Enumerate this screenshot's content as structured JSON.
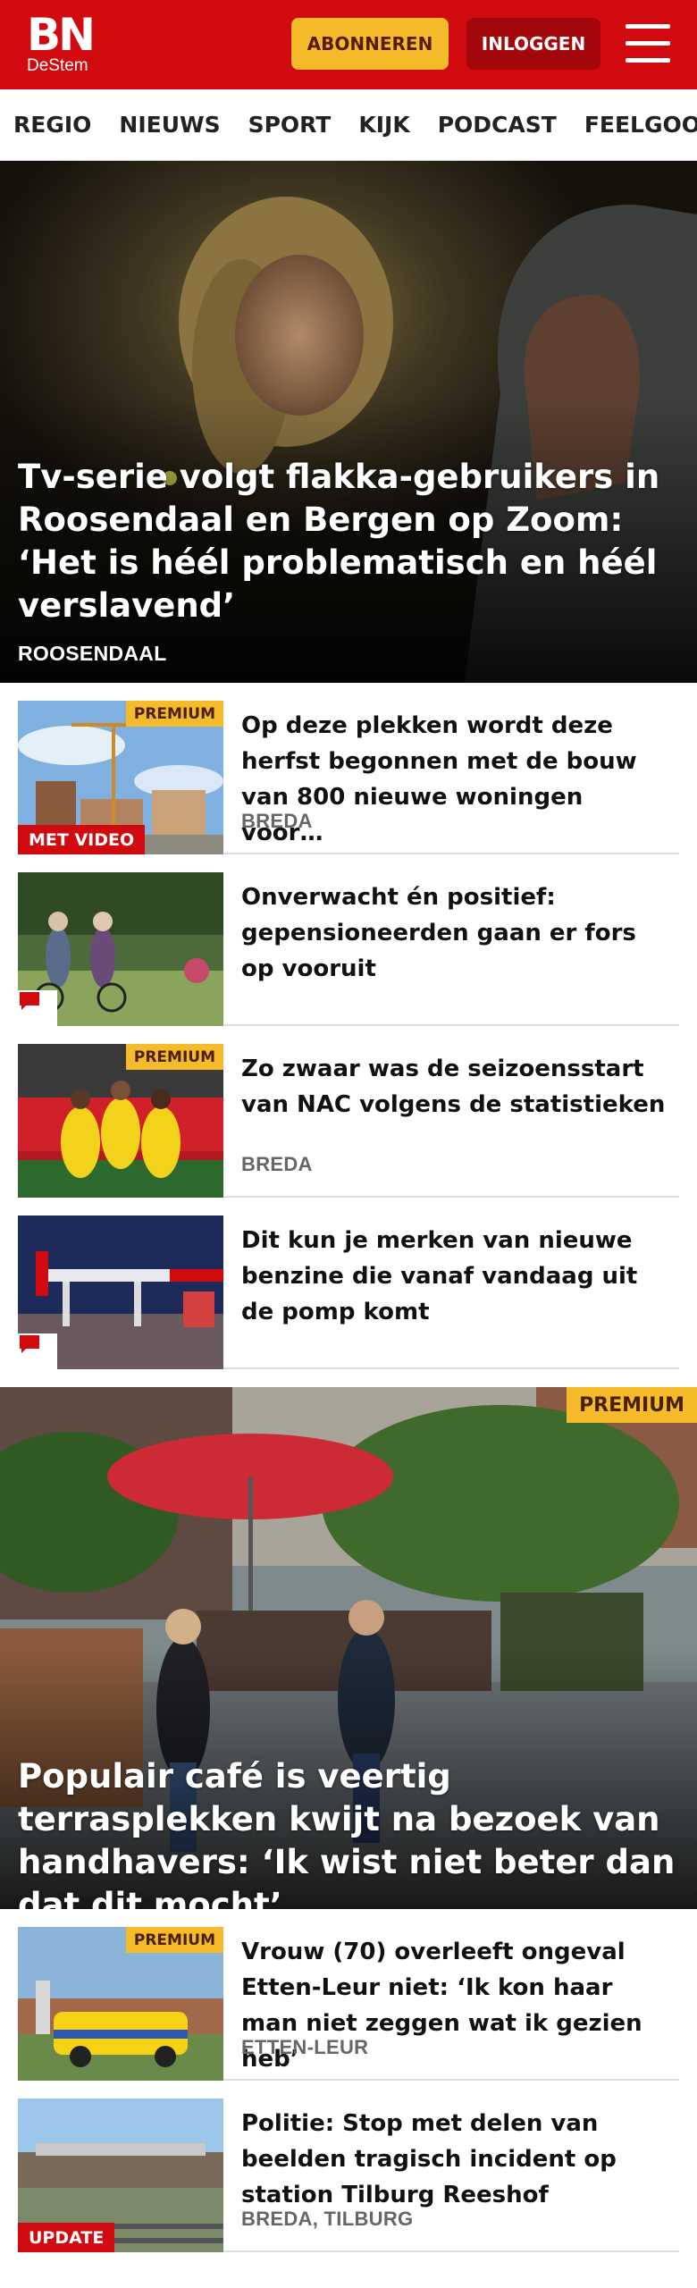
{
  "header": {
    "logo_main": "BN",
    "logo_sub": "DeStem",
    "subscribe_label": "ABONNEREN",
    "login_label": "INLOGGEN",
    "menu_icon": "hamburger-menu-icon",
    "brand_color": "#d10a10",
    "accent_color": "#f5bb2a"
  },
  "nav": {
    "items": [
      "REGIO",
      "NIEUWS",
      "SPORT",
      "KIJK",
      "PODCAST",
      "FEELGOOD"
    ]
  },
  "hero": {
    "title": "Tv-serie volgt flakka-gebruikers in Roosendaal en Bergen op Zoom: ‘Het is héél problematisch en héél verslavend’",
    "location": "ROOSENDAAL"
  },
  "articles": [
    {
      "title": "Op deze plekken wordt deze herfst begonnen met de bouw van 800 nieuwe woningen voor…",
      "location": "BREDA",
      "premium": "PREMIUM",
      "video": "MET VIDEO"
    },
    {
      "title": "Onverwacht én positief: gepensioneerden gaan er fors op vooruit",
      "location": "",
      "comment_icon": "comment-icon"
    },
    {
      "title": "Zo zwaar was de seizoensstart van NAC volgens de statistieken",
      "location": "BREDA",
      "premium": "PREMIUM"
    },
    {
      "title": "Dit kun je merken van nieuwe benzine die vanaf vandaag uit de pomp komt",
      "location": "",
      "comment_icon": "comment-icon"
    }
  ],
  "feature": {
    "premium": "PREMIUM",
    "title": "Populair café is veertig terrasplekken kwijt na bezoek van handhavers: ‘Ik wist niet beter dan dat dit mocht’"
  },
  "articles2": [
    {
      "title": "Vrouw (70) overleeft ongeval Etten-Leur niet: ‘Ik kon haar man niet zeggen wat ik gezien heb’",
      "location": "ETTEN-LEUR",
      "premium": "PREMIUM"
    },
    {
      "title": "Politie: Stop met delen van beelden tragisch incident op station Tilburg Reeshof",
      "location": "BREDA, TILBURG",
      "update": "UPDATE"
    }
  ]
}
